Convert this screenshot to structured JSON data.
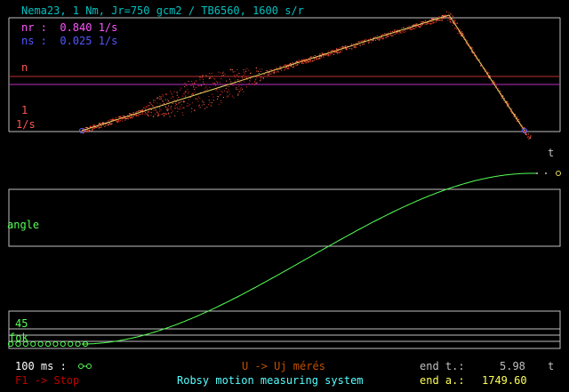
{
  "header": {
    "title": "Nema23, 1 Nm, Jr=750 gcm2 / TB6560, 1600 s/r",
    "nr": "nr :  0.840 1/s",
    "ns": "ns :  0.025 1/s"
  },
  "speed_panel": {
    "n_label": "n",
    "one_label": "1",
    "unit_label": "1/s"
  },
  "t_label": "t",
  "angle_label": "angle",
  "lower_panel": {
    "value_label": "45",
    "unit_label": "fok"
  },
  "footer": {
    "time_scale": "100 ms :",
    "new_measure": "U -> Uj mérés",
    "stop": "F1 -> Stop",
    "system_name": "Robsy motion measuring system",
    "end_t_label": "end t.:",
    "end_t_value": "5.98",
    "end_t_unit": "t",
    "end_a_label": "end a.:",
    "end_a_value": "1749.60"
  },
  "colors": {
    "title": "#00c0c0",
    "nr": "#ff55ff",
    "ns": "#5555ff",
    "speed": "#ff5555",
    "angle": "#55ff55",
    "frame": "#c0c0c0",
    "footer_orange": "#c05000",
    "footer_stop": "#c00000",
    "footer_cyan": "#55ffff",
    "footer_yellow": "#ffff55"
  }
}
